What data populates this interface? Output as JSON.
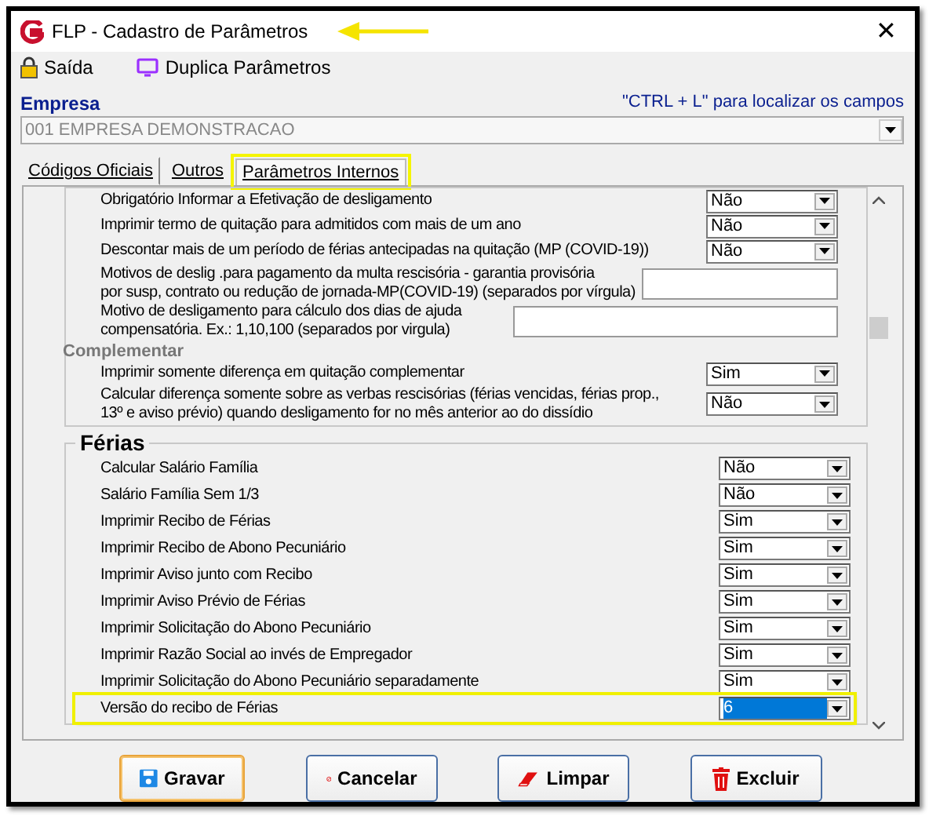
{
  "window": {
    "title": "FLP - Cadastro de Parâmetros",
    "arrow": true,
    "close": "✕"
  },
  "toolbar": [
    {
      "kind": "lock",
      "label": "Saída"
    },
    {
      "kind": "monitor",
      "label": "Duplica Parâmetros"
    }
  ],
  "empresa": {
    "label": "Empresa",
    "hint": "\"CTRL + L\" para localizar os campos",
    "value": "001 EMPRESA DEMONSTRACAO",
    "disabled": true
  },
  "tabs": [
    {
      "label": "Códigos Oficiais",
      "selected": false,
      "highlighted": false
    },
    {
      "label": "Outros",
      "selected": false,
      "highlighted": false
    },
    {
      "label": "Parâmetros Internos",
      "selected": true,
      "highlighted": true
    }
  ],
  "rescisao_rows": [
    {
      "kind": "combo",
      "label": "Obrigatório Informar a Efetivação de desligamento",
      "value": "Não"
    },
    {
      "kind": "combo",
      "label": "Imprimir termo de quitação para admitidos com mais de um ano",
      "value": "Não"
    },
    {
      "kind": "combo",
      "label": "Descontar mais de um período de férias antecipadas na quitação (MP (COVID-19))",
      "value": "Não"
    },
    {
      "kind": "text",
      "label": "Motivos de deslig .para pagamento da multa rescisória - garantia provisória\npor susp, contrato ou redução de jornada-MP(COVID-19) (separados por vírgula)"
    },
    {
      "kind": "text",
      "label": "Motivo de desligamento para cálculo dos dias de ajuda\ncompensatória. Ex.: 1,10,100 (separados por virgula)"
    }
  ],
  "complementar": {
    "title": "Complementar",
    "rows": [
      {
        "kind": "combo",
        "label": "Imprimir somente diferença em quitação complementar",
        "value": "Sim"
      },
      {
        "kind": "combo",
        "label": "Calcular diferença somente sobre as verbas rescisórias (férias vencidas, férias prop.,\n13º e aviso prévio) quando desligamento for no mês anterior ao do dissídio",
        "value": "Não"
      }
    ]
  },
  "ferias": {
    "title": "Férias",
    "rows": [
      {
        "label": "Calcular Salário Família",
        "value": "Não",
        "selected": false,
        "highlighted": false
      },
      {
        "label": "Salário Família Sem 1/3",
        "value": "Não",
        "selected": false,
        "highlighted": false
      },
      {
        "label": "Imprimir Recibo de Férias",
        "value": "Sim",
        "selected": false,
        "highlighted": false
      },
      {
        "label": "Imprimir Recibo de Abono Pecuniário",
        "value": "Sim",
        "selected": false,
        "highlighted": false
      },
      {
        "label": "Imprimir Aviso junto com Recibo",
        "value": "Sim",
        "selected": false,
        "highlighted": false
      },
      {
        "label": "Imprimir Aviso Prévio de Férias",
        "value": "Sim",
        "selected": false,
        "highlighted": false
      },
      {
        "label": "Imprimir Solicitação do Abono Pecuniário",
        "value": "Sim",
        "selected": false,
        "highlighted": false
      },
      {
        "label": "Imprimir Razão Social ao invés de Empregador",
        "value": "Sim",
        "selected": false,
        "highlighted": false
      },
      {
        "label": "Imprimir Solicitação do Abono Pecuniário separadamente",
        "value": "Sim",
        "selected": false,
        "highlighted": false
      },
      {
        "label": "Versão do recibo de Férias",
        "value": "6",
        "selected": true,
        "highlighted": true
      }
    ]
  },
  "buttons": [
    {
      "kind": "save",
      "label": "Gravar",
      "focused": true
    },
    {
      "kind": "cancel",
      "label": "Cancelar",
      "focused": false
    },
    {
      "kind": "eraser",
      "label": "Limpar",
      "focused": false
    },
    {
      "kind": "trash",
      "label": "Excluir",
      "focused": false
    }
  ]
}
